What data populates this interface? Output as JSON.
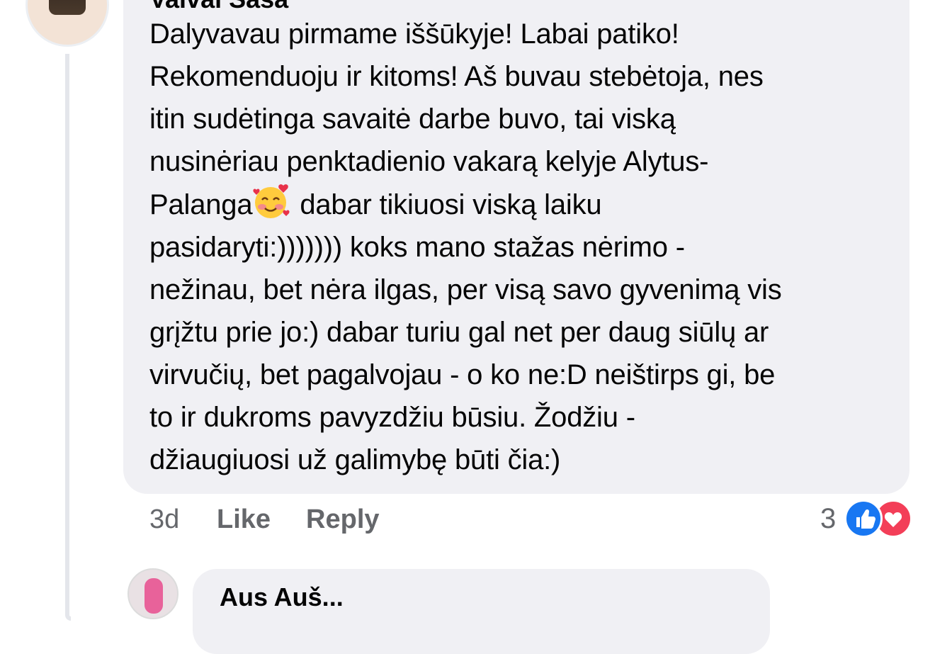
{
  "comment": {
    "author": "Vaivai Šaša",
    "text_lines": [
      "Dalyvavau pirmame iššūkyje! Labai patiko!",
      "Rekomenduoju ir kitoms! Aš buvau stebėtoja, nes",
      "itin sudėtinga savaitė darbe buvo, tai viską",
      "nusinėriau penktadienio vakarą kelyje Alytus-",
      "Palanga",
      " dabar tikiuosi viską laiku",
      "pasidaryti:))))))) koks mano stažas nėrimo -",
      "nežinau, bet nėra ilgas, per visą savo gyvenimą vis",
      "grįžtu prie jo:) dabar turiu gal net per daug siūlų ar",
      "virvučių, bet pagalvojau - o ko ne:D neištirps gi, be",
      "to ir dukroms pavyzdžiu būsiu. Žodžiu -",
      "džiaugiuosi už galimybę būti čia:)"
    ],
    "emoji": "smiling-face-with-hearts",
    "time": "3d",
    "like_label": "Like",
    "reply_label": "Reply",
    "reaction_count": "3",
    "reactions": [
      "like",
      "love"
    ]
  },
  "next_comment": {
    "author": "Aus Auš..."
  },
  "colors": {
    "bubble": "#f0f0f4",
    "meta_text": "#65676b",
    "like_blue": "#1877f2",
    "love_red": "#f33e58"
  }
}
